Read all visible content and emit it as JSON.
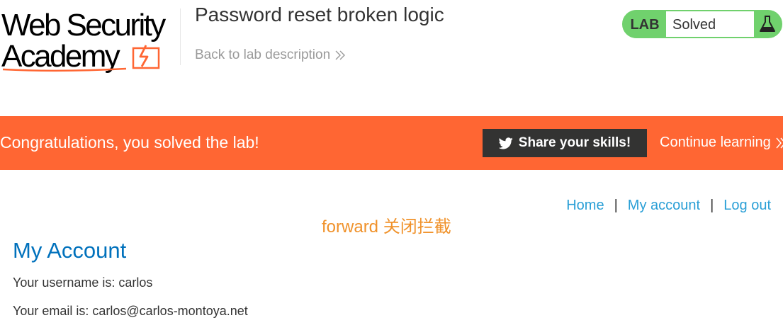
{
  "header": {
    "logo": {
      "line1": "Web Security",
      "line2": "Academy"
    },
    "lab_title": "Password reset broken logic",
    "back_link": "Back to lab description",
    "status": {
      "label": "LAB",
      "value": "Solved"
    }
  },
  "banner": {
    "message": "Congratulations, you solved the lab!",
    "share_button": "Share your skills!",
    "continue_link": "Continue learning"
  },
  "nav": {
    "items": [
      "Home",
      "My account",
      "Log out"
    ],
    "separator": "|"
  },
  "overlay": {
    "text": "forward 关闭拦截"
  },
  "account": {
    "title": "My Account",
    "username_line": "Your username is: carlos",
    "email_line": "Your email is: carlos@carlos-montoya.net"
  },
  "colors": {
    "banner": "#ff6633",
    "status_green": "#70d16d",
    "link_blue": "#2a9fd6",
    "title_blue": "#0071bc",
    "overlay_orange": "#f0922b"
  },
  "icons": {
    "share": "twitter-icon",
    "status": "flask-icon",
    "chevrons": "double-chevron-right-icon",
    "logo_mark": "lightning-bolt-icon"
  }
}
